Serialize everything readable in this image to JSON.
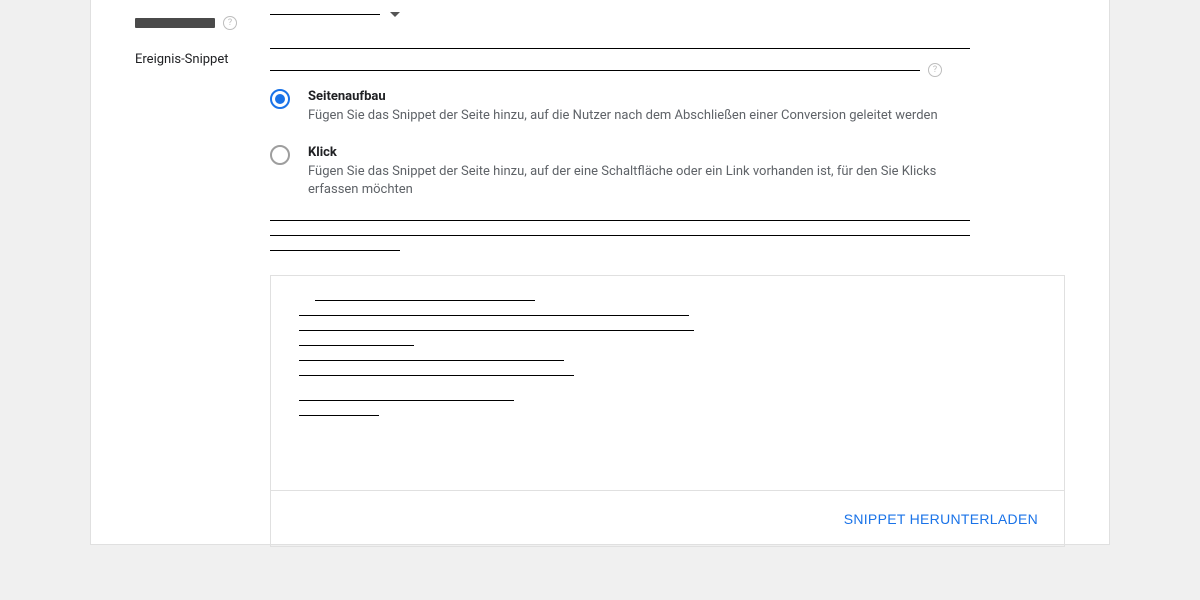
{
  "section": {
    "snippet_label": "Ereignis-Snippet"
  },
  "radios": {
    "pageload": {
      "title": "Seitenaufbau",
      "desc": "Fügen Sie das Snippet der Seite hinzu, auf die Nutzer nach dem Abschließen einer Conversion geleitet werden"
    },
    "click": {
      "title": "Klick",
      "desc": "Fügen Sie das Snippet der Seite hinzu, auf der eine Schaltfläche oder ein Link vorhanden ist, für den Sie Klicks erfassen möchten"
    }
  },
  "actions": {
    "download": "SNIPPET HERUNTERLADEN"
  }
}
